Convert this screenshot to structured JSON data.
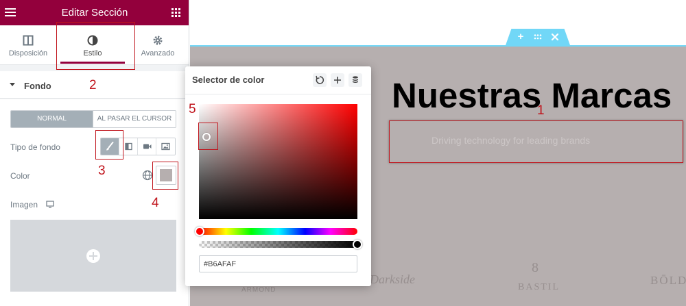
{
  "panel": {
    "title": "Editar Sección",
    "tabs": [
      {
        "label": "Disposición",
        "icon": "columns-icon"
      },
      {
        "label": "Estilo",
        "icon": "contrast-icon",
        "active": true
      },
      {
        "label": "Avanzado",
        "icon": "gear-icon"
      }
    ],
    "section_title": "Fondo",
    "states": {
      "normal": "NORMAL",
      "hover": "AL PASAR EL CURSOR",
      "active": "normal"
    },
    "bg_type_label": "Tipo de fondo",
    "bg_types": [
      "brush-icon",
      "gradient-icon",
      "video-icon",
      "slideshow-icon"
    ],
    "color_label": "Color",
    "image_label": "Imagen",
    "selected_color": "#B6AFAF"
  },
  "picker": {
    "title": "Selector de color",
    "hex_value": "#B6AFAF",
    "hue_color": "#ff0000"
  },
  "preview": {
    "title": "Nuestras Marcas",
    "subtitle": "Driving technology for leading brands",
    "brands": [
      "ARMOND",
      "Darkside",
      "BASTIL",
      "BŌLD"
    ],
    "bastil_mark": "8",
    "background": "#B6AFAF",
    "accent": "#71D7F7"
  },
  "annotations": [
    "1",
    "2",
    "3",
    "4",
    "5"
  ],
  "colors": {
    "header": "#93003C",
    "annotation": "#C0141C"
  }
}
